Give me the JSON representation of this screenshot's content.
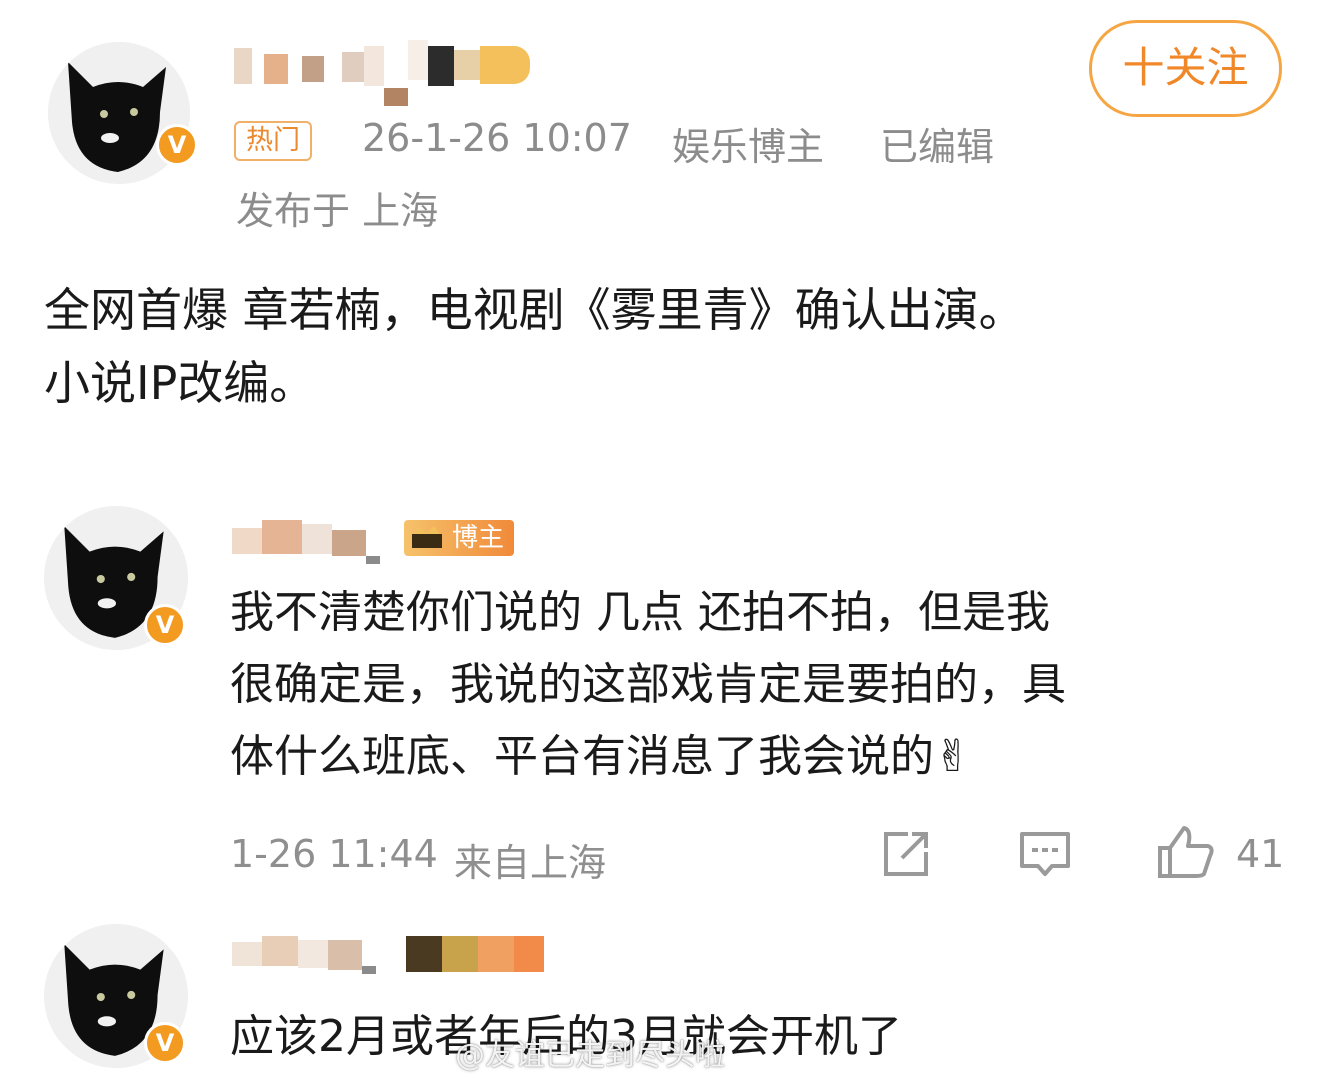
{
  "post": {
    "follow_label": "十关注",
    "hot_label": "热门",
    "time": "26-1-26 10:07",
    "category": "娱乐博主",
    "edited": "已编辑",
    "location": "发布于 上海",
    "text_line1": "全网首爆  章若楠，电视剧《雾里青》确认出演。",
    "text_line2": "小说IP改编。",
    "verified_badge": "V"
  },
  "comments": [
    {
      "badge": "博主",
      "lines": [
        "我不清楚你们说的 几点 还拍不拍，但是我",
        "很确定是，我说的这部戏肯定是要拍的，具",
        "体什么班底、平台有消息了我会说的✌"
      ],
      "time": "1-26 11:44",
      "location": "来自上海",
      "likes": "41",
      "verified_badge": "V"
    },
    {
      "lines": [
        "应该2月或者年后的3月就会开机了"
      ],
      "verified_badge": "V"
    }
  ],
  "watermark": "@友谊已走到尽头啦",
  "colors": {
    "accent": "#f0882a",
    "meta_gray": "#8c8c8c",
    "verified": "#f39a21"
  },
  "icons": [
    "cat-avatar-icon",
    "verified-badge-icon",
    "crown-icon",
    "share-icon",
    "comment-icon",
    "like-icon",
    "weibo-logo-icon"
  ]
}
